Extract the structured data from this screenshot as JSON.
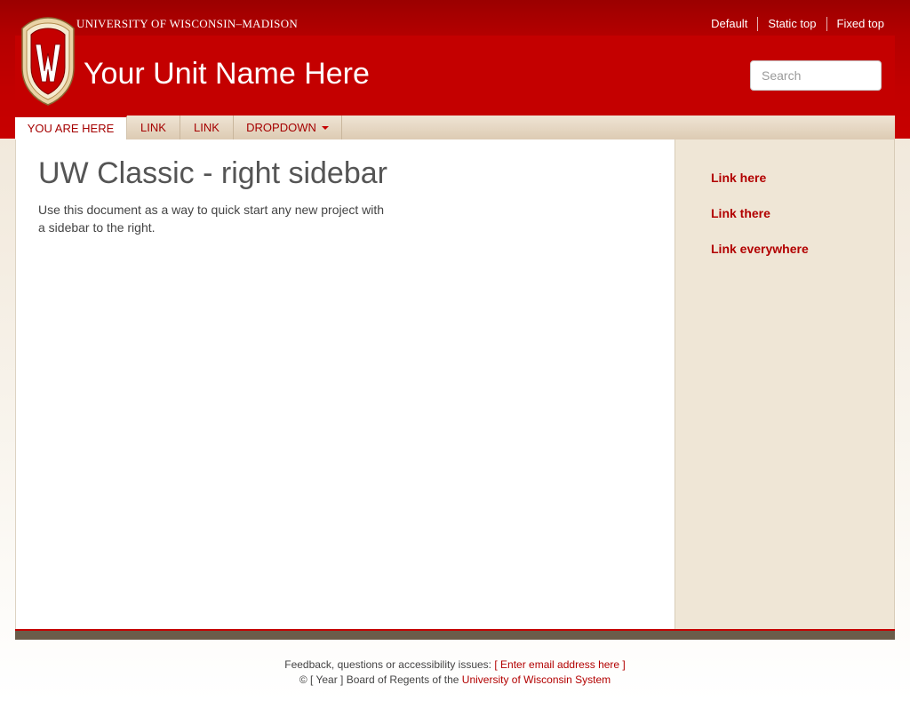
{
  "header": {
    "university_name": "UNIVERSITY OF WISCONSIN–MADISON",
    "unit_name": "Your Unit Name Here",
    "crest_letter": "W",
    "top_links": [
      "Default",
      "Static top",
      "Fixed top"
    ],
    "search": {
      "placeholder": "Search",
      "value": ""
    }
  },
  "nav": {
    "items": [
      {
        "label": "YOU ARE HERE",
        "active": true
      },
      {
        "label": "LINK",
        "active": false
      },
      {
        "label": "LINK",
        "active": false
      },
      {
        "label": "DROPDOWN",
        "active": false,
        "has_caret": true
      }
    ]
  },
  "main": {
    "title": "UW Classic - right sidebar",
    "intro": "Use this document as a way to quick start any new project with a sidebar to the right."
  },
  "sidebar": {
    "links": [
      "Link here",
      "Link there",
      "Link everywhere"
    ]
  },
  "footer": {
    "feedback_text": "Feedback, questions or accessibility issues:",
    "email_link": "[ Enter email address here ]",
    "copyright_text": "© [ Year ] Board of Regents of the",
    "system_link": "University of Wisconsin System"
  },
  "colors": {
    "brand_red": "#c50000",
    "sidebar_bg": "#efe6d6",
    "footer_bar": "#6b5c4a"
  }
}
